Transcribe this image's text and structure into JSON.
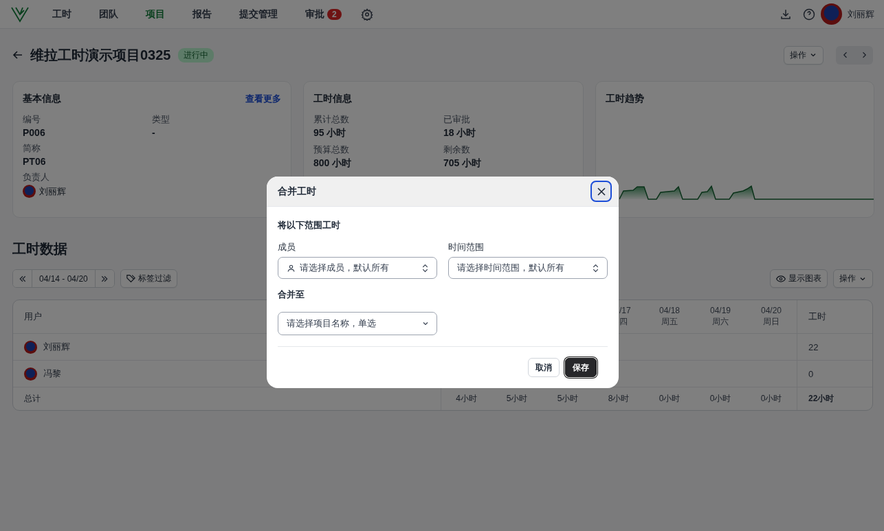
{
  "nav": {
    "items": [
      {
        "label": "工时",
        "selected": false
      },
      {
        "label": "团队",
        "selected": false
      },
      {
        "label": "项目",
        "selected": true
      },
      {
        "label": "报告",
        "selected": false
      },
      {
        "label": "提交管理",
        "selected": false
      },
      {
        "label": "审批",
        "selected": false,
        "badge": "2"
      }
    ],
    "user": {
      "name": "刘丽辉"
    }
  },
  "header": {
    "title": "维拉工时演示项目0325",
    "status": "进行中",
    "actions": "操作"
  },
  "cards": {
    "basic": {
      "title": "基本信息",
      "link": "查看更多",
      "fields": [
        {
          "label": "编号",
          "value": "P006"
        },
        {
          "label": "类型",
          "value": "-"
        },
        {
          "label": "简称",
          "value": "PT06"
        }
      ],
      "owner": {
        "label": "负责人",
        "name": "刘丽辉"
      }
    },
    "hours": {
      "title": "工时信息",
      "fields": [
        {
          "label": "累计总数",
          "value": "95 小时"
        },
        {
          "label": "已审批",
          "value": "18 小时"
        },
        {
          "label": "预算总数",
          "value": "800 小时"
        },
        {
          "label": "剩余数",
          "value": "705 小时"
        }
      ]
    },
    "trend": {
      "title": "工时趋势"
    }
  },
  "section": {
    "title": "工时数据",
    "range": "04/14 - 04/20",
    "tag_filter": "标签过滤",
    "show_chart": "显示图表",
    "actions": "操作"
  },
  "table": {
    "user_header": "用户",
    "total_header": "工时",
    "day_columns": [
      {
        "date": "/17",
        "weekday": "四",
        "cut": true
      },
      {
        "date": "04/18",
        "weekday": "周五",
        "cut": false
      },
      {
        "date": "04/19",
        "weekday": "周六",
        "cut": false
      },
      {
        "date": "04/20",
        "weekday": "周日",
        "cut": false
      }
    ],
    "rows": [
      {
        "name": "刘丽辉",
        "total": "22"
      },
      {
        "name": "冯黎",
        "total": "0"
      }
    ],
    "footer": {
      "label": "总计",
      "day_totals": [
        "4小时",
        "5小时",
        "5小时",
        "8小时",
        "0小时",
        "0小时",
        "0小时"
      ],
      "total": "22小时"
    }
  },
  "modal": {
    "title": "合并工时",
    "close_focused": true,
    "scope_title": "将以下范围工时",
    "member": {
      "label": "成员",
      "placeholder": "请选择成员，默认所有"
    },
    "period": {
      "label": "时间范围",
      "placeholder": "请选择时间范围，默认所有"
    },
    "target_title": "合并至",
    "target": {
      "placeholder": "请选择项目名称，单选"
    },
    "buttons": {
      "cancel": "取消",
      "save": "保存"
    }
  }
}
